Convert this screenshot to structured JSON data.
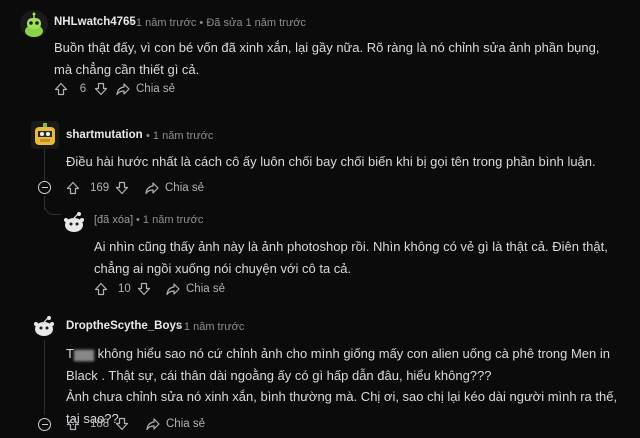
{
  "comments": [
    {
      "username": "NHLwatch4765",
      "time": "1 năm trước",
      "edited": "Đã sửa 1 năm trước",
      "body": "Buồn thật đấy, vì con bé vốn đã xinh xắn, lại gầy nữa. Rõ ràng là nó chỉnh sửa ảnh phần bụng, mà chẳng cần thiết gì cả.",
      "votes": "6",
      "share_label": "Chia sẻ",
      "avatar_icon": "green-bot-avatar-icon"
    },
    {
      "username": "shartmutation",
      "time": "1 năm trước",
      "body": "Điều hài hước nhất là cách cô ấy luôn chối bay chối biến khi bị gọi tên trong phần bình luận.",
      "votes": "169",
      "share_label": "Chia sẻ",
      "avatar_icon": "yellow-robot-avatar-icon"
    },
    {
      "username": "[đã xóa]",
      "time": "1 năm trước",
      "body": "Ai nhìn cũng thấy ảnh này là ảnh photoshop rồi. Nhìn không có vẻ gì là thật cả. Điên thật, chẳng ai ngồi xuống nói chuyện với cô ta cả.",
      "votes": "10",
      "share_label": "Chia sẻ",
      "avatar_icon": "white-snoo-avatar-icon"
    },
    {
      "username": "DroptheScythe_Boys",
      "time": "1 năm trước",
      "body_prefix": "T",
      "body_censored": "▆▆",
      "body_line1": " không hiểu sao nó cứ chỉnh ảnh cho mình giống mấy con alien uống cà phê trong Men in Black . Thật sự, cái thân dài ngoằng ấy có gì hấp dẫn đâu, hiểu không???",
      "body_line2": "Ảnh chưa chỉnh sửa nó xinh xắn, bình thường mà. Chị ơi, sao chị lại kéo dài người mình ra thế, tại sao??",
      "votes": "188",
      "share_label": "Chia sẻ",
      "avatar_icon": "white-snoo-avatar-icon"
    }
  ],
  "dot_separator": "•",
  "colors": {
    "background": "#0b0b0c",
    "text": "#d7dadc",
    "meta": "#8b8f93",
    "thread_line": "#2d3033"
  }
}
